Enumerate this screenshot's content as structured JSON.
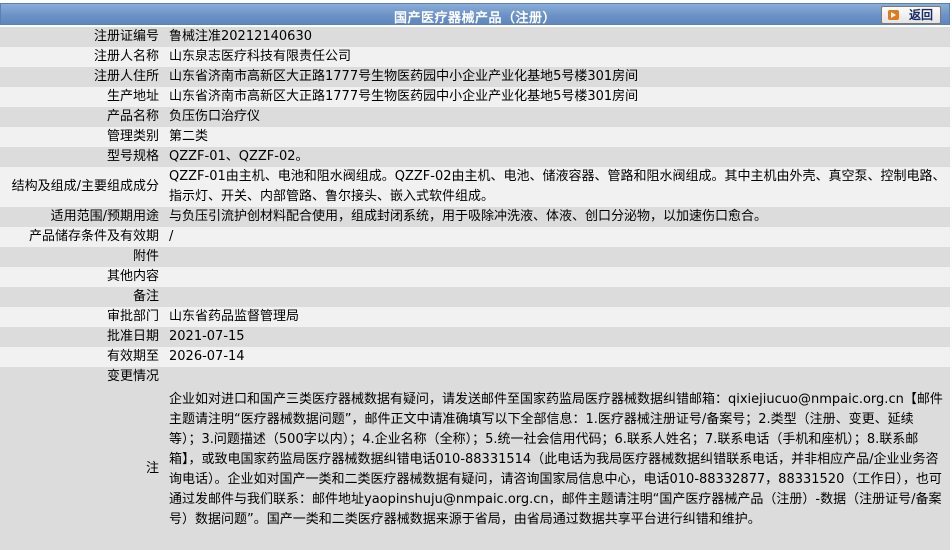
{
  "header": {
    "title": "国产医疗器械产品（注册）",
    "back_label": "返回"
  },
  "rows": [
    {
      "label": "注册证编号",
      "value": "鲁械注准20212140630"
    },
    {
      "label": "注册人名称",
      "value": "山东泉志医疗科技有限责任公司"
    },
    {
      "label": "注册人住所",
      "value": "山东省济南市高新区大正路1777号生物医药园中小企业产业化基地5号楼301房间"
    },
    {
      "label": "生产地址",
      "value": "山东省济南市高新区大正路1777号生物医药园中小企业产业化基地5号楼301房间"
    },
    {
      "label": "产品名称",
      "value": "负压伤口治疗仪"
    },
    {
      "label": "管理类别",
      "value": "第二类"
    },
    {
      "label": "型号规格",
      "value": "QZZF-01、QZZF-02。"
    },
    {
      "label": "结构及组成/主要组成成分",
      "value": "QZZF-01由主机、电池和阻水阀组成。QZZF-02由主机、电池、储液容器、管路和阻水阀组成。其中主机由外壳、真空泵、控制电路、指示灯、开关、内部管路、鲁尔接头、嵌入式软件组成。"
    },
    {
      "label": "适用范围/预期用途",
      "value": "与负压引流护创材料配合使用，组成封闭系统，用于吸除冲洗液、体液、创口分泌物，以加速伤口愈合。"
    },
    {
      "label": "产品储存条件及有效期",
      "value": "/"
    },
    {
      "label": "附件",
      "value": ""
    },
    {
      "label": "其他内容",
      "value": ""
    },
    {
      "label": "备注",
      "value": ""
    },
    {
      "label": "审批部门",
      "value": "山东省药品监督管理局"
    },
    {
      "label": "批准日期",
      "value": "2021-07-15"
    },
    {
      "label": "有效期至",
      "value": "2026-07-14"
    },
    {
      "label": "变更情况",
      "value": ""
    }
  ],
  "note": {
    "label": "注",
    "text": "企业如对进口和国产三类医疗器械数据有疑问，请发送邮件至国家药监局医疗器械数据纠错邮箱：qixiejiucuo@nmpaic.org.cn【邮件主题请注明“医疗器械数据问题”，邮件正文中请准确填写以下全部信息：1.医疗器械注册证号/备案号；2.类型（注册、变更、延续等）；3.问题描述（500字以内）；4.企业名称（全称）；5.统一社会信用代码；6.联系人姓名；7.联系电话（手机和座机）；8.联系邮箱】，或致电国家药监局医疗器械数据纠错电话010-88331514（此电话为我局医疗器械数据纠错联系电话，并非相应产品/企业业务咨询电话）。企业如对国产一类和二类医疗器械数据有疑问，请咨询国家局信息中心，电话010-88332877，88331520（工作日），也可通过发邮件与我们联系：邮件地址yaopinshuju@nmpaic.org.cn，邮件主题请注明“国产医疗器械产品（注册）-数据（注册证号/备案号）数据问题”。国产一类和二类医疗器械数据来源于省局，由省局通过数据共享平台进行纠错和维护。"
  },
  "colors": {
    "title_bar": "#6c93c8",
    "row_dark": "#dcdcdc",
    "row_light": "#f1f1f1",
    "back_icon": "#e07a1a"
  }
}
